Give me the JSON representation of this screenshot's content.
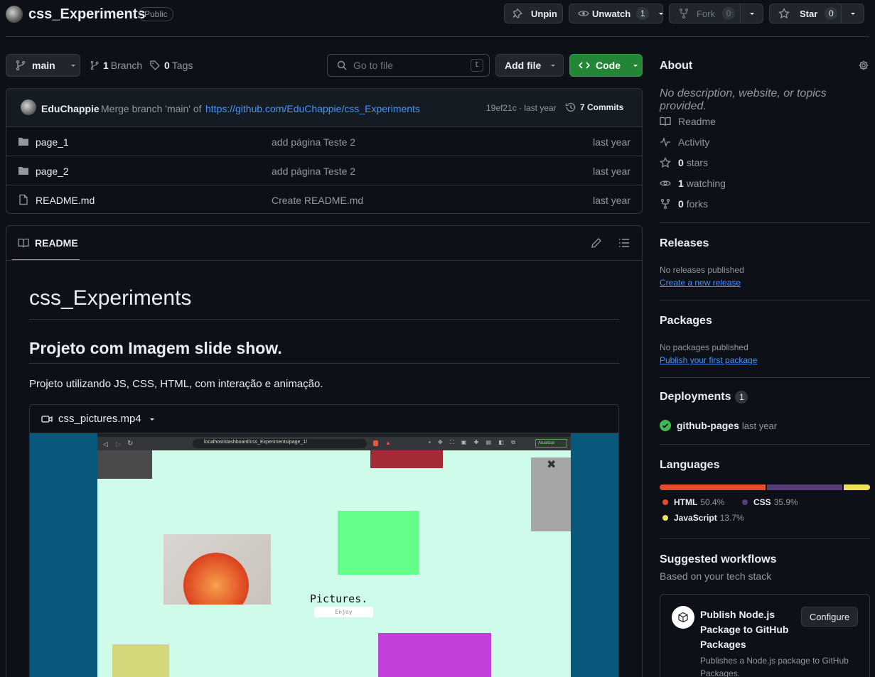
{
  "repo": {
    "name": "css_Experiments",
    "visibility": "Public"
  },
  "actions": {
    "unpin": "Unpin",
    "unwatch": "Unwatch",
    "watch_count": "1",
    "fork": "Fork",
    "fork_count": "0",
    "star": "Star",
    "star_count": "0"
  },
  "toolbar": {
    "branch": "main",
    "branches_count": "1",
    "branches_label": "Branch",
    "tags_count": "0",
    "tags_label": "Tags",
    "search_placeholder": "Go to file",
    "search_shortcut": "t",
    "add_file": "Add file",
    "code": "Code"
  },
  "commit": {
    "author": "EduChappie",
    "message": "Merge branch 'main' of",
    "link": "https://github.com/EduChappie/css_Experiments",
    "hash_time": "19ef21c · last year",
    "commits_label": "7 Commits"
  },
  "files": [
    {
      "type": "folder",
      "name": "page_1",
      "message": "add página Teste 2",
      "time": "last year"
    },
    {
      "type": "folder",
      "name": "page_2",
      "message": "add página Teste 2",
      "time": "last year"
    },
    {
      "type": "file",
      "name": "README.md",
      "message": "Create README.md",
      "time": "last year"
    }
  ],
  "readme": {
    "tab": "README",
    "h1": "css_Experiments",
    "h2": "Projeto com Imagem slide show.",
    "paragraph": "Projeto utilizando JS, CSS, HTML, com interação e animação.",
    "video_name": "css_pictures.mp4",
    "video_frame": {
      "address": "localhost/dashboard/css_Experiments/page_1/",
      "update_button": "Atualizar",
      "pictures_title": "Pictures.",
      "enjoy_button": "Enjoy"
    }
  },
  "about": {
    "title": "About",
    "description": "No description, website, or topics provided.",
    "items": [
      {
        "icon": "book-icon",
        "label": "Readme"
      },
      {
        "icon": "pulse-icon",
        "label": "Activity"
      },
      {
        "icon": "star-icon",
        "count": "0",
        "label": "stars"
      },
      {
        "icon": "eye-icon",
        "count": "1",
        "label": "watching"
      },
      {
        "icon": "fork-icon",
        "count": "0",
        "label": "forks"
      }
    ]
  },
  "releases": {
    "title": "Releases",
    "empty": "No releases published",
    "link": "Create a new release"
  },
  "packages": {
    "title": "Packages",
    "empty": "No packages published",
    "link": "Publish your first package"
  },
  "deployments": {
    "title": "Deployments",
    "count": "1",
    "name": "github-pages",
    "time": "last year"
  },
  "languages": {
    "title": "Languages",
    "items": [
      {
        "name": "HTML",
        "percent": "50.4%",
        "value": 50.4,
        "color": "#e34c26"
      },
      {
        "name": "CSS",
        "percent": "35.9%",
        "value": 35.9,
        "color": "#563d7c"
      },
      {
        "name": "JavaScript",
        "percent": "13.7%",
        "value": 13.7,
        "color": "#f1e05a"
      }
    ]
  },
  "workflows": {
    "title": "Suggested workflows",
    "subtitle": "Based on your tech stack",
    "card": {
      "title_lines": [
        "Publish Node.js",
        "Package to GitHub",
        "Packages"
      ],
      "button": "Configure",
      "desc_lines": [
        "Publishes a Node.js package to GitHub",
        "Packages."
      ]
    }
  },
  "colors": {
    "accent_green": "#238636",
    "link": "#4493f8",
    "underline_active": "#f78166"
  }
}
